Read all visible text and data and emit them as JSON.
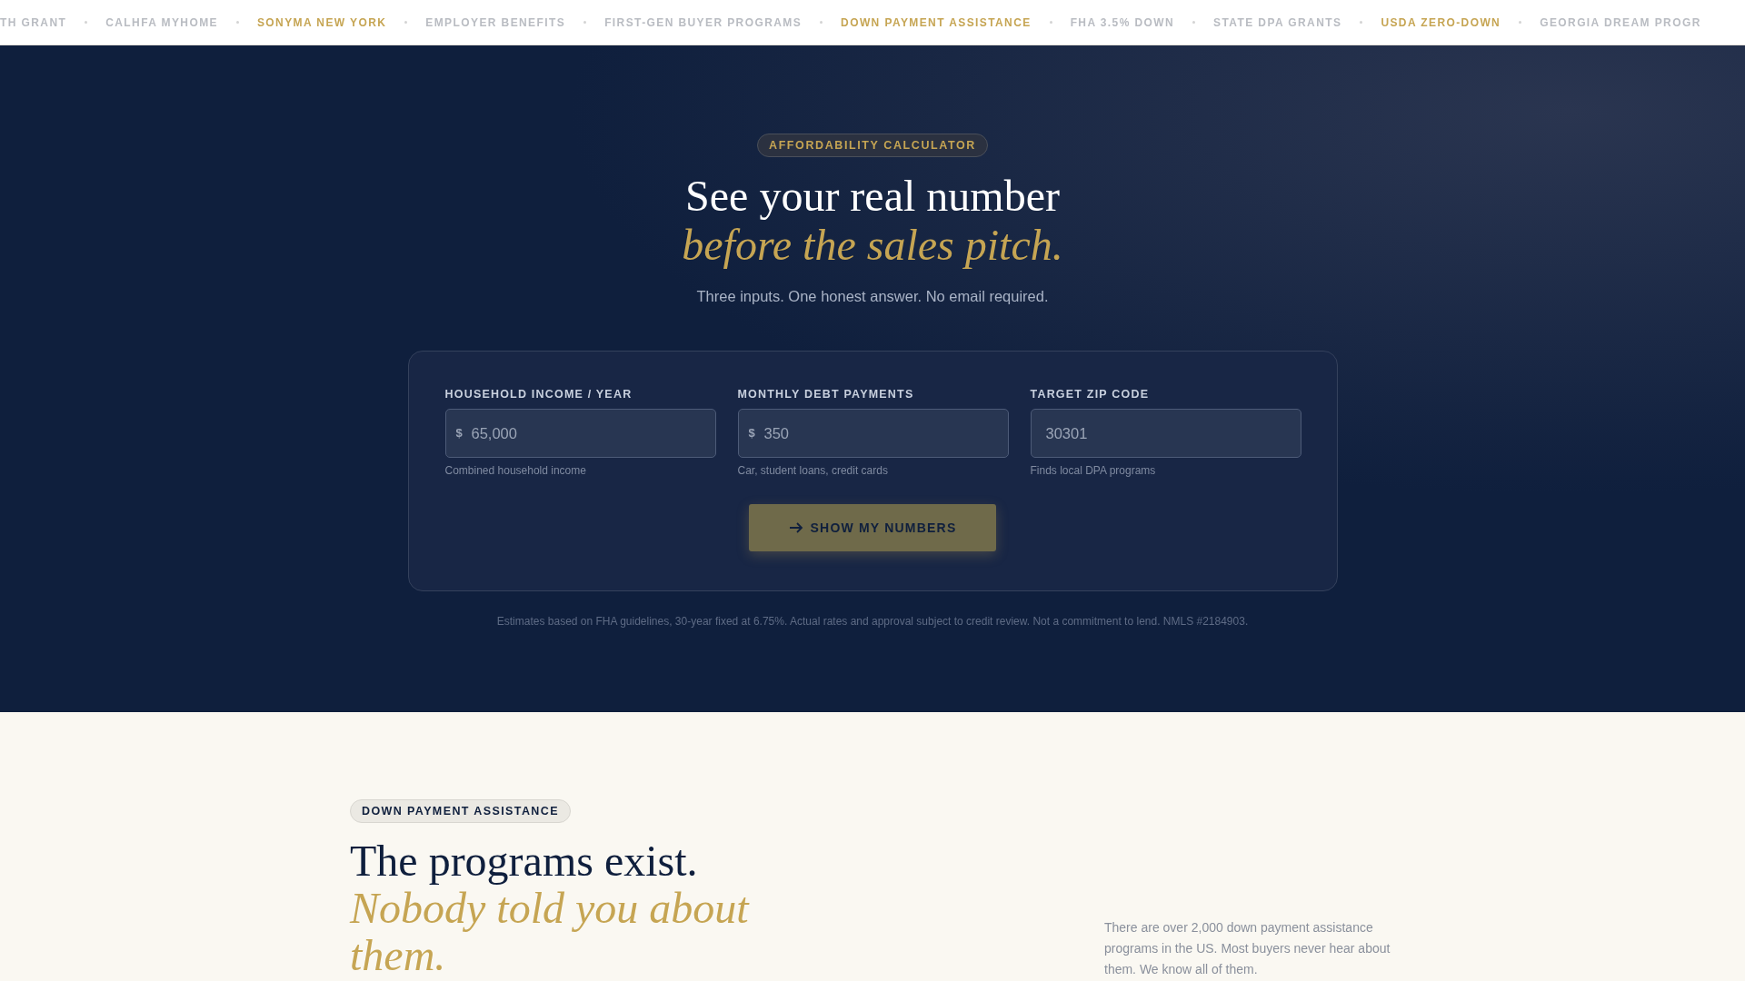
{
  "ticker": [
    {
      "label": "TH GRANT",
      "highlighted": false
    },
    {
      "label": "CALHFA MYHOME",
      "highlighted": false
    },
    {
      "label": "SONYMA NEW YORK",
      "highlighted": true
    },
    {
      "label": "EMPLOYER BENEFITS",
      "highlighted": false
    },
    {
      "label": "FIRST-GEN BUYER PROGRAMS",
      "highlighted": false
    },
    {
      "label": "DOWN PAYMENT ASSISTANCE",
      "highlighted": true
    },
    {
      "label": "FHA 3.5% DOWN",
      "highlighted": false
    },
    {
      "label": "STATE DPA GRANTS",
      "highlighted": false
    },
    {
      "label": "USDA ZERO-DOWN",
      "highlighted": true
    },
    {
      "label": "GEORGIA DREAM PROGR",
      "highlighted": false
    }
  ],
  "hero": {
    "badge": "AFFORDABILITY CALCULATOR",
    "title": "See your real number",
    "title_accent": "before the sales pitch.",
    "subtitle": "Three inputs. One honest answer. No email required.",
    "fields": [
      {
        "label": "HOUSEHOLD INCOME / YEAR",
        "prefix": "$",
        "placeholder": "65,000",
        "hint": "Combined household income"
      },
      {
        "label": "MONTHLY DEBT PAYMENTS",
        "prefix": "$",
        "placeholder": "350",
        "hint": "Car, student loans, credit cards"
      },
      {
        "label": "TARGET ZIP CODE",
        "placeholder": "30301",
        "hint": "Finds local DPA programs"
      }
    ],
    "button": "SHOW MY NUMBERS",
    "disclaimer": "Estimates based on FHA guidelines, 30-year fixed at 6.75%. Actual rates and approval subject to credit review. Not a commitment to lend. NMLS #2184903."
  },
  "programs": {
    "badge": "DOWN PAYMENT ASSISTANCE",
    "title": "The programs exist.",
    "title_accent": "Nobody told you about them.",
    "body": "There are over 2,000 down payment assistance programs in the US. Most buyers never hear about them. We know all of them."
  }
}
